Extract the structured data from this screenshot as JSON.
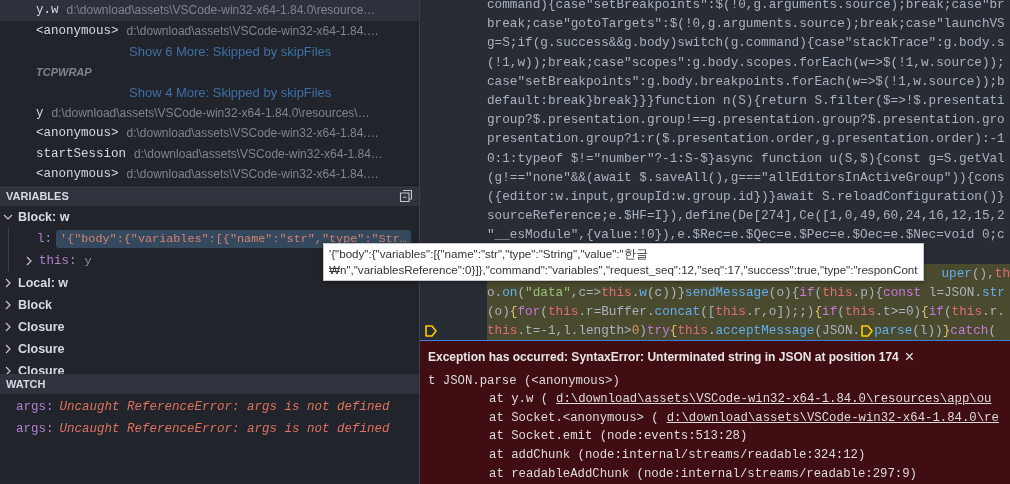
{
  "call_stack": [
    {
      "kind": "frame",
      "name": "y.w",
      "path": "d:\\download\\assets\\VSCode-win32-x64-1.84.0\\resource…",
      "selected": true
    },
    {
      "kind": "frame",
      "name": "<anonymous>",
      "path": "d:\\download\\assets\\VSCode-win32-x64-1.84.…",
      "selected": false
    },
    {
      "kind": "more",
      "label": "Show 6 More: Skipped by skipFiles",
      "selected": false
    },
    {
      "kind": "label",
      "label": "TCPWRAP",
      "selected": false
    },
    {
      "kind": "more",
      "label": "Show 4 More: Skipped by skipFiles",
      "selected": false
    },
    {
      "kind": "frame",
      "name": "y",
      "path": "d:\\download\\assets\\VSCode-win32-x64-1.84.0\\resources\\…",
      "selected": false
    },
    {
      "kind": "frame",
      "name": "<anonymous>",
      "path": "d:\\download\\assets\\VSCode-win32-x64-1.84.…",
      "selected": false
    },
    {
      "kind": "frame",
      "name": "startSession",
      "path": "d:\\download\\assets\\VSCode-win32-x64-1.84…",
      "selected": false
    },
    {
      "kind": "frame",
      "name": "<anonymous>",
      "path": "d:\\download\\assets\\VSCode-win32-x64-1.84.…",
      "selected": false
    }
  ],
  "variables": {
    "title": "VARIABLES",
    "items": [
      {
        "label": "Block: w",
        "expanded": true,
        "selected": false,
        "children": [
          {
            "name": "l:",
            "value": "'{\"body\":{\"variables\":[{\"name\":\"str\",\"type\":\"Str…",
            "selected": true
          },
          {
            "name": "this:",
            "value": "y",
            "expanded": false,
            "selected": false
          }
        ]
      },
      {
        "label": "Local: w",
        "expanded": false,
        "selected": false
      },
      {
        "label": "Block",
        "expanded": false,
        "selected": false
      },
      {
        "label": "Closure",
        "expanded": false,
        "selected": false
      },
      {
        "label": "Closure",
        "expanded": false,
        "selected": false
      },
      {
        "label": "Closure",
        "expanded": false,
        "selected": false
      }
    ]
  },
  "watch": {
    "title": "WATCH",
    "items": [
      {
        "name": "args:",
        "value": "Uncaught ReferenceError: args is not defined"
      },
      {
        "name": "args:",
        "value": "Uncaught ReferenceError: args is not defined"
      }
    ]
  },
  "editor": {
    "lines": [
      {
        "kind": "plain",
        "text": "command){case\"setBreakpoints\":$(!0,g.arguments.source);break;case\"br"
      },
      {
        "kind": "plain",
        "text": "break;case\"gotoTargets\":$(!0,g.arguments.source);break;case\"launchVS"
      },
      {
        "kind": "plain",
        "text": "g=S;if(g.success&&g.body)switch(g.command){case\"stackTrace\":g.body.s"
      },
      {
        "kind": "plain",
        "text": "(!1,w));break;case\"scopes\":g.body.scopes.forEach(w=>$(!1,w.source));"
      },
      {
        "kind": "plain",
        "text": "case\"setBreakpoints\":g.body.breakpoints.forEach(w=>$(!1,w.source));b"
      },
      {
        "kind": "plain",
        "text": "default:break}break}}}function n(S){return S.filter($=>!$.presentati"
      },
      {
        "kind": "plain",
        "text": "group?$.presentation.group!==g.presentation.group?$.presentation.gro"
      },
      {
        "kind": "plain",
        "text": "presentation.group?1:r($.presentation.order,g.presentation.order):-1"
      },
      {
        "kind": "plain",
        "text": "0:1:typeof $!=\"number\"?-1:S-$}async function u(S,$){const g=S.getVal"
      },
      {
        "kind": "plain",
        "text": "(g!==\"none\"&&(await $.saveAll(),g===\"allEditorsInActiveGroup\")){cons"
      },
      {
        "kind": "plain",
        "text": "({editor:w.input,groupId:w.group.id})}await S.reloadConfiguration()}"
      },
      {
        "kind": "plain",
        "text": "sourceReference;e.$HF=I}),define(De[274],Ce([1,0,49,60,24,16,12,15,2"
      },
      {
        "kind": "plain",
        "text": "\"__esModule\",{value:!0}),e.$Rec=e.$Qec=e.$Pec=e.$Oec=e.$Nec=void 0;c"
      },
      {
        "kind": "blank"
      },
      {
        "kind": "tail",
        "highlighted": true,
        "segments": [
          {
            "kind": "func",
            "text": "uper"
          },
          {
            "kind": "plain",
            "text": "(),"
          },
          {
            "kind": "this",
            "text": "th"
          }
        ]
      },
      {
        "kind": "tokens",
        "highlighted": true,
        "segments": [
          {
            "kind": "plain",
            "text": "o."
          },
          {
            "kind": "func",
            "text": "on"
          },
          {
            "kind": "plain",
            "text": "("
          },
          {
            "kind": "string",
            "text": "\"data\""
          },
          {
            "kind": "plain",
            "text": ",c=>"
          },
          {
            "kind": "this",
            "text": "this"
          },
          {
            "kind": "plain",
            "text": "."
          },
          {
            "kind": "func",
            "text": "w"
          },
          {
            "kind": "plain",
            "text": "(c))}"
          },
          {
            "kind": "func",
            "text": "sendMessage"
          },
          {
            "kind": "plain",
            "text": "(o){"
          },
          {
            "kind": "keyword",
            "text": "if"
          },
          {
            "kind": "plain",
            "text": "("
          },
          {
            "kind": "this",
            "text": "this"
          },
          {
            "kind": "plain",
            "text": ".p){"
          },
          {
            "kind": "keyword",
            "text": "const"
          },
          {
            "kind": "plain",
            "text": " l=JSON."
          },
          {
            "kind": "func",
            "text": "str"
          }
        ]
      },
      {
        "kind": "tokens",
        "highlighted": true,
        "segments": [
          {
            "kind": "plain",
            "text": "(o)"
          },
          {
            "kind": "bracket",
            "text": "{"
          },
          {
            "kind": "keyword",
            "text": "for"
          },
          {
            "kind": "plain",
            "text": "("
          },
          {
            "kind": "this",
            "text": "this"
          },
          {
            "kind": "plain",
            "text": ".r=Buffer."
          },
          {
            "kind": "func",
            "text": "concat"
          },
          {
            "kind": "plain",
            "text": "(["
          },
          {
            "kind": "this",
            "text": "this"
          },
          {
            "kind": "plain",
            "text": ".r,o]);;)"
          },
          {
            "kind": "bracket",
            "text": "{"
          },
          {
            "kind": "keyword",
            "text": "if"
          },
          {
            "kind": "plain",
            "text": "("
          },
          {
            "kind": "this",
            "text": "this"
          },
          {
            "kind": "plain",
            "text": ".t>=0)"
          },
          {
            "kind": "bracket",
            "text": "{"
          },
          {
            "kind": "keyword",
            "text": "if"
          },
          {
            "kind": "plain",
            "text": "("
          },
          {
            "kind": "this",
            "text": "this"
          },
          {
            "kind": "plain",
            "text": ".r."
          }
        ]
      },
      {
        "kind": "tokens",
        "highlighted": true,
        "frame": true,
        "segments": [
          {
            "kind": "this",
            "text": "this"
          },
          {
            "kind": "plain",
            "text": ".t=-1,l.length>"
          },
          {
            "kind": "number",
            "text": "0"
          },
          {
            "kind": "plain",
            "text": ")"
          },
          {
            "kind": "keyword",
            "text": "try"
          },
          {
            "kind": "bracket",
            "text": "{"
          },
          {
            "kind": "this",
            "text": "this"
          },
          {
            "kind": "plain",
            "text": "."
          },
          {
            "kind": "func",
            "text": "acceptMessage"
          },
          {
            "kind": "plain",
            "text": "(JSON."
          },
          {
            "kind": "marker"
          },
          {
            "kind": "func",
            "text": "parse"
          },
          {
            "kind": "plain",
            "text": "(l))"
          },
          {
            "kind": "bracket",
            "text": "}"
          },
          {
            "kind": "keyword",
            "text": "catch"
          },
          {
            "kind": "plain",
            "text": "("
          }
        ]
      }
    ]
  },
  "tooltip": {
    "lines": [
      "'{\"body\":{\"variables\":[{\"name\":\"str\",\"type\":\"String\",\"value\":\"한글",
      "₩n\",\"variablesReference\":0}]},\"command\":\"variables\",\"request_seq\":12,\"seq\":17,\"success\":true,\"type\":\"responCont"
    ]
  },
  "exception": {
    "title": "Exception has occurred: SyntaxError: Unterminated string in JSON at position 174",
    "close": "×",
    "trace": [
      {
        "kind": "head",
        "text": "t JSON.parse (<anonymous>)"
      },
      {
        "kind": "frame",
        "text": "at y.w (",
        "link": "d:\\download\\assets\\VSCode-win32-x64-1.84.0\\resources\\app\\ou"
      },
      {
        "kind": "frame",
        "text": "at Socket.<anonymous> (",
        "link": "d:\\download\\assets\\VSCode-win32-x64-1.84.0\\re"
      },
      {
        "kind": "frame",
        "text": "at Socket.emit (node:events:513:28)"
      },
      {
        "kind": "frame",
        "text": "at addChunk (node:internal/streams/readable:324:12)"
      },
      {
        "kind": "frame",
        "text": "at readableAddChunk (node:internal/streams/readable:297:9)"
      }
    ]
  }
}
